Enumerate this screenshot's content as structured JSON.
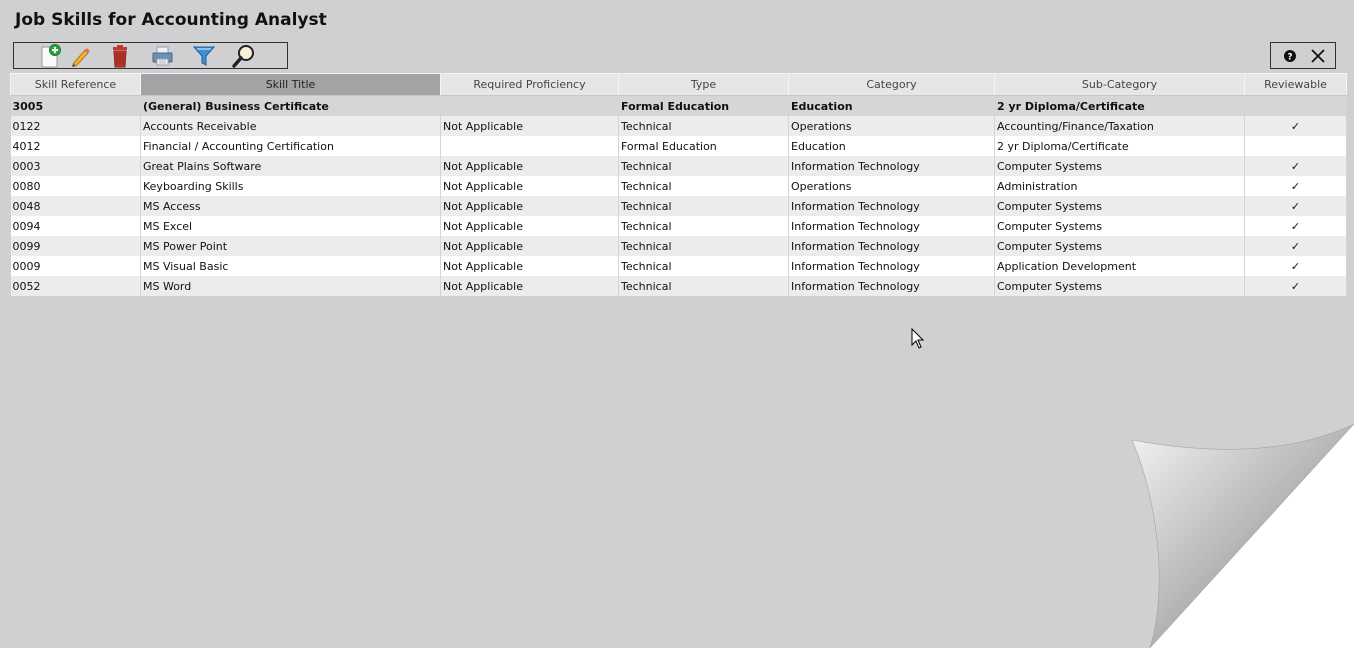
{
  "page": {
    "title": "Job Skills for Accounting Analyst"
  },
  "toolbar": {
    "buttons": [
      {
        "name": "add-icon"
      },
      {
        "name": "edit-icon"
      },
      {
        "name": "delete-icon"
      },
      {
        "name": "print-icon"
      },
      {
        "name": "filter-icon"
      },
      {
        "name": "search-icon"
      }
    ],
    "right": {
      "help_icon": "help-icon",
      "close_icon": "close-icon"
    }
  },
  "table": {
    "columns": [
      "Skill Reference",
      "Skill Title",
      "Required Proficiency",
      "Type",
      "Category",
      "Sub-Category",
      "Reviewable"
    ],
    "sorted_column": "Skill Title",
    "rows": [
      {
        "ref": "3005",
        "title": "(General) Business Certificate",
        "proficiency": "",
        "type": "Formal Education",
        "category": "Education",
        "subcategory": "2 yr Diploma/Certificate",
        "reviewable": ""
      },
      {
        "ref": "0122",
        "title": "Accounts Receivable",
        "proficiency": "Not Applicable",
        "type": "Technical",
        "category": "Operations",
        "subcategory": "Accounting/Finance/Taxation",
        "reviewable": "✓"
      },
      {
        "ref": "4012",
        "title": "Financial / Accounting Certification",
        "proficiency": "",
        "type": "Formal Education",
        "category": "Education",
        "subcategory": "2 yr Diploma/Certificate",
        "reviewable": ""
      },
      {
        "ref": "0003",
        "title": "Great Plains Software",
        "proficiency": "Not Applicable",
        "type": "Technical",
        "category": "Information Technology",
        "subcategory": "Computer Systems",
        "reviewable": "✓"
      },
      {
        "ref": "0080",
        "title": "Keyboarding Skills",
        "proficiency": "Not Applicable",
        "type": "Technical",
        "category": "Operations",
        "subcategory": "Administration",
        "reviewable": "✓"
      },
      {
        "ref": "0048",
        "title": "MS Access",
        "proficiency": "Not Applicable",
        "type": "Technical",
        "category": "Information Technology",
        "subcategory": "Computer Systems",
        "reviewable": "✓"
      },
      {
        "ref": "0094",
        "title": "MS Excel",
        "proficiency": "Not Applicable",
        "type": "Technical",
        "category": "Information Technology",
        "subcategory": "Computer Systems",
        "reviewable": "✓"
      },
      {
        "ref": "0099",
        "title": "MS Power Point",
        "proficiency": "Not Applicable",
        "type": "Technical",
        "category": "Information Technology",
        "subcategory": "Computer Systems",
        "reviewable": "✓"
      },
      {
        "ref": "0009",
        "title": "MS Visual Basic",
        "proficiency": "Not Applicable",
        "type": "Technical",
        "category": "Information Technology",
        "subcategory": "Application Development",
        "reviewable": "✓"
      },
      {
        "ref": "0052",
        "title": "MS Word",
        "proficiency": "Not Applicable",
        "type": "Technical",
        "category": "Information Technology",
        "subcategory": "Computer Systems",
        "reviewable": "✓"
      }
    ]
  },
  "colors": {
    "background": "#d0d0d2",
    "header_sorted": "#a3a3a5",
    "row_alt": "#ececec"
  }
}
